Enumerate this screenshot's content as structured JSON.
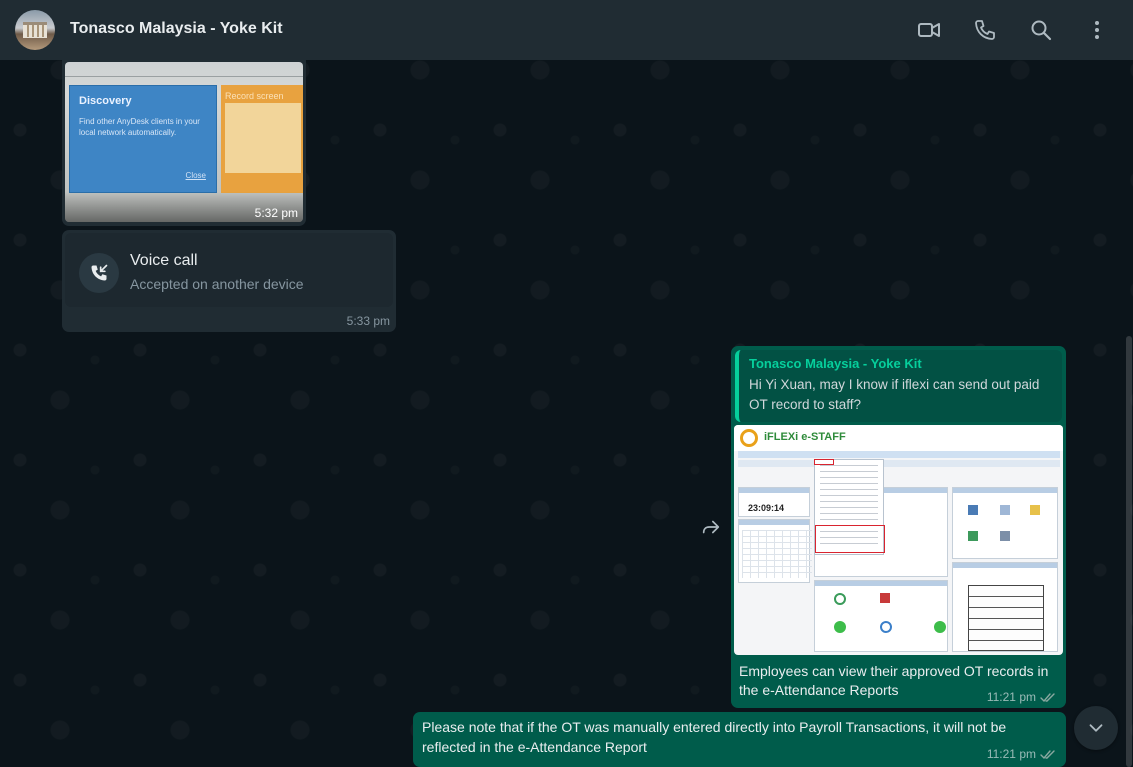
{
  "header": {
    "title": "Tonasco Malaysia - Yoke Kit",
    "icons": [
      "video-call-icon",
      "voice-call-icon",
      "search-icon",
      "menu-icon"
    ]
  },
  "messages": {
    "image_1": {
      "photo": {
        "discovery_title": "Discovery",
        "discovery_text": "Find other AnyDesk clients in your local network automatically.",
        "close_link": "Close",
        "orange_title": "Record screen"
      },
      "time": "5:32 pm"
    },
    "voice_call": {
      "title": "Voice call",
      "subtitle": "Accepted on another device",
      "time": "5:33 pm"
    },
    "reply": {
      "quote_name": "Tonasco Malaysia - Yoke Kit",
      "quote_text": "Hi Yi Xuan, may I know if iflexi can send out paid OT record to staff?",
      "screenshot": {
        "logo": "iFLEXi e-STAFF",
        "clock": "23:09:14"
      },
      "body": "Employees can view their approved OT records in the e-Attendance Reports",
      "time": "11:21 pm"
    },
    "last": {
      "body": "Please note that if the OT was manually entered directly into Payroll Transactions, it will not be reflected in the e-Attendance Report",
      "time": "11:21 pm"
    }
  },
  "colors": {
    "header_bg": "#202c33",
    "chat_bg": "#0b141a",
    "incoming_bubble": "#202c33",
    "outgoing_bubble": "#005c4b",
    "accent": "#06cf9c",
    "read_ticks": "#8696a0"
  }
}
